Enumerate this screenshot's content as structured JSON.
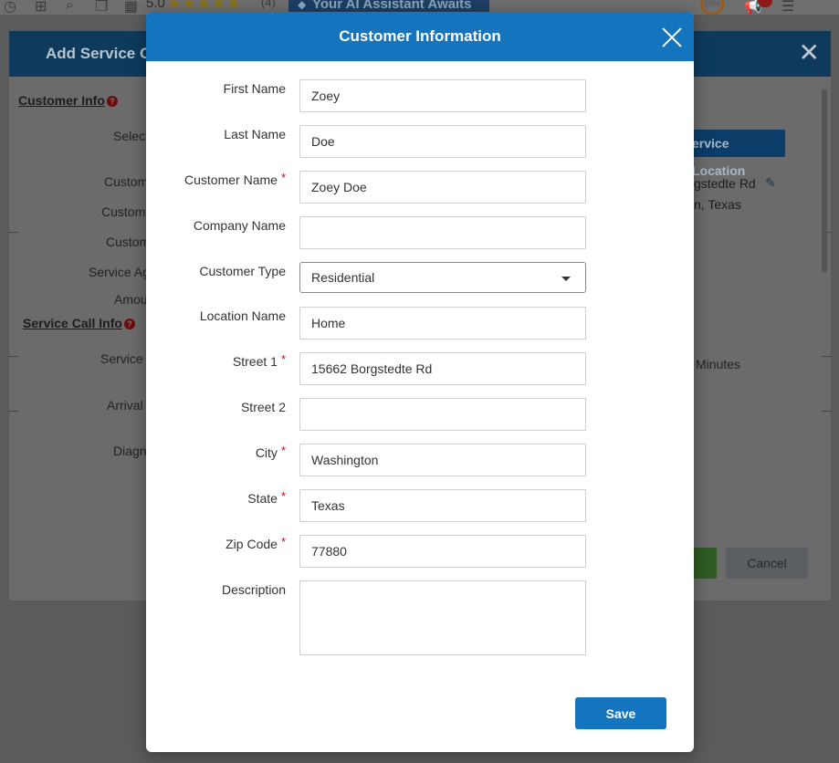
{
  "topbar": {
    "rating": "5.0",
    "stars": "★★★★★",
    "review_count": "(4)",
    "ai_banner": "Your AI Assistant Awaits",
    "percent": "80%"
  },
  "background_modal": {
    "title": "Add Service Call",
    "customer_info_link": "Customer Info",
    "service_call_info_link": "Service Call Info",
    "partial_labels": [
      "Select",
      "Custom",
      "Custome",
      "Custom",
      "Service Ag",
      "Amou",
      "Service",
      "Arrival",
      "Diagn"
    ],
    "service_location_button": "ervice Location",
    "address_line1": "gstedte Rd",
    "address_line2": "n, Texas",
    "minutes_label": "Minutes",
    "cancel_button": "Cancel"
  },
  "modal": {
    "title": "Customer Information",
    "fields": {
      "first_name": {
        "label": "First Name",
        "value": "Zoey"
      },
      "last_name": {
        "label": "Last Name",
        "value": "Doe"
      },
      "customer_name": {
        "label": "Customer Name",
        "value": "Zoey Doe",
        "required": "*"
      },
      "company_name": {
        "label": "Company Name",
        "value": ""
      },
      "customer_type": {
        "label": "Customer Type",
        "value": "Residential"
      },
      "location_name": {
        "label": "Location Name",
        "value": "Home"
      },
      "street1": {
        "label": "Street 1",
        "value": "15662 Borgstedte Rd",
        "required": "*"
      },
      "street2": {
        "label": "Street 2",
        "value": ""
      },
      "city": {
        "label": "City",
        "value": "Washington",
        "required": "*"
      },
      "state": {
        "label": "State",
        "value": "Texas",
        "required": "*"
      },
      "zip": {
        "label": "Zip Code",
        "value": "77880",
        "required": "*"
      },
      "description": {
        "label": "Description",
        "value": ""
      }
    },
    "save_label": "Save"
  }
}
